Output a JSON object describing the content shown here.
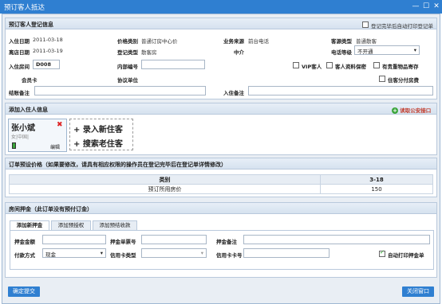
{
  "window": {
    "title": "预订客人抵达"
  },
  "guest_info": {
    "section_title": "预订客人登记信息",
    "auto_print_label": "登记完毕后自动打印登记单",
    "checkin_date_label": "入住日期",
    "checkin_date": "2011-03-18",
    "checkout_date_label": "离店日期",
    "checkout_date": "2011-03-19",
    "price_type_label": "价格类别",
    "price_type": "普通订房中心价",
    "reg_type_label": "登记类型",
    "reg_type": "散客房",
    "source_label": "业务来源",
    "source": "前台电话",
    "agent_label": "中介",
    "guest_type_label": "客源类型",
    "guest_type": "普通散客",
    "phone_level_label": "电话等级",
    "phone_level": "不开通",
    "room_label": "入住房间",
    "room": "D008",
    "internal_no_label": "内部编号",
    "vip_label": "VIP客人",
    "confidential_label": "客人资料保密",
    "valuables_label": "有贵重物品寄存",
    "member_card_label": "会员卡",
    "agreement_label": "协议单位",
    "split_pay_label": "住客分付房费",
    "checkout_note_label": "结账备注",
    "checkin_note_label": "入住备注"
  },
  "add_guest": {
    "section_title": "添加入住人信息",
    "read_id_label": "读取公安接口",
    "guest_name": "张小斌",
    "guest_sub": "女|中国|",
    "edit_label": "编辑",
    "new_guest_label": "+ 录入新住客",
    "search_guest_label": "+ 搜索老住客"
  },
  "pricing": {
    "section_title": "订单预设价格（如果要修改，请具有相应权限的操作员在登记完毕后在登记单详情修改）",
    "col_category": "类别",
    "col_date": "3-18",
    "row_label": "预订所用房价",
    "row_value": "150"
  },
  "deposit": {
    "section_title": "房间押金（此订单没有预付订金）",
    "tabs": [
      "添加新押金",
      "添加预授权",
      "添加预结收款"
    ],
    "amount_label": "押金金额",
    "receipt_label": "押金单票号",
    "note_label": "押金备注",
    "pay_method_label": "付款方式",
    "pay_method": "现金",
    "card_type_label": "信用卡类型",
    "card_no_label": "信用卡卡号",
    "auto_print_label": "自动打印押金单"
  },
  "footer": {
    "confirm_label": "确定提交",
    "close_label": "关闭窗口"
  }
}
